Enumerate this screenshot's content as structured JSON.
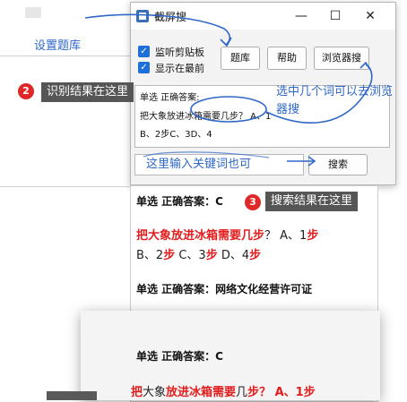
{
  "annotations": {
    "set_library": "设置题库",
    "recognize_result": "识别结果在这里",
    "select_words": "选中几个词可以去浏览器搜",
    "enter_keywords": "这里输入关键词也可",
    "search_result": "搜索结果在这里",
    "badge_2": "2",
    "badge_3": "3"
  },
  "window": {
    "title": "截屏搜",
    "minimize": "—",
    "maximize": "☐",
    "close": "✕"
  },
  "options": {
    "monitor_clipboard": "监听剪贴板",
    "always_on_top": "显示在最前"
  },
  "buttons": {
    "library": "题库",
    "help": "帮助",
    "browser_search": "浏览器搜",
    "search": "搜索"
  },
  "recognized": {
    "line1": "单选 正确答案:",
    "line2": "把大象放进冰箱需要几步？ A、1",
    "line3": "B、2步C、3D、4"
  },
  "results": {
    "q1_head": "单选 正确答案：C",
    "q1_l1_a": "把大象放进冰箱需要几",
    "q1_l1_b": "步",
    "q1_l1_c": "？ A、1",
    "q1_l1_d": "步",
    "q1_l2_a": "B、2",
    "q1_l2_b": "步",
    "q1_l2_c": " C、3",
    "q1_l2_d": "步",
    "q1_l2_e": " D、4",
    "q1_l2_f": "步",
    "q2_head": "单选 正确答案：网络文化经营许可证"
  },
  "popup": {
    "head": "单选 正确答案：C",
    "l1_a": "把",
    "l1_b": "大象",
    "l1_c": "放进冰箱需要",
    "l1_d": "几",
    "l1_e": "步",
    "l1_f": "？ A、1",
    "l1_g": "步"
  },
  "colors": {
    "accent_blue": "#2e67c8",
    "highlight_red": "#e21d1d",
    "badge_red": "#e02828"
  }
}
